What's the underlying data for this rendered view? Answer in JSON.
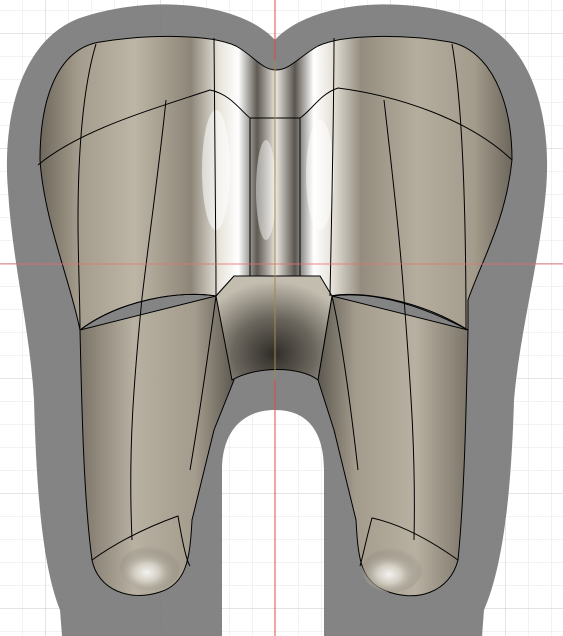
{
  "viewport": {
    "background_color": "#ffffff",
    "grid": {
      "visible": true,
      "minor_color": "#e4e4e4",
      "major_color": "#c9c9c9"
    },
    "axes": {
      "vertical_axis_color": "#e04848",
      "horizontal_axis_color": "#e87070"
    }
  },
  "model": {
    "name_icon": "tooth-model-icon",
    "material_colors": {
      "base": "#9a9282",
      "light": "#c8c2b3",
      "dark": "#4a4640",
      "highlight": "#ffffff",
      "edge_line": "#000000"
    },
    "offset_shadow_color": "#7a7a7a"
  }
}
